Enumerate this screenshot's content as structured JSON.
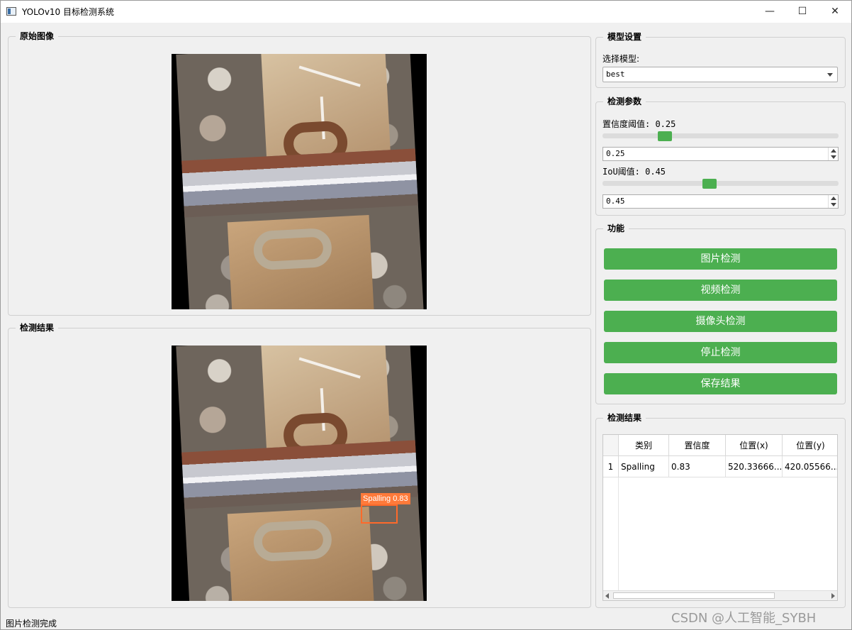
{
  "window": {
    "title": "YOLOv10 目标检测系统",
    "minimize_glyph": "—",
    "maximize_glyph": "☐",
    "close_glyph": "✕"
  },
  "original_panel": {
    "title": "原始图像"
  },
  "result_panel": {
    "title": "检测结果"
  },
  "detection_overlay": {
    "label": "Spalling  0.83",
    "color": "#ff6a2a"
  },
  "model_settings": {
    "title": "模型设置",
    "select_label": "选择模型:",
    "selected_model": "best"
  },
  "params": {
    "title": "检测参数",
    "conf_label": "置信度阈值: 0.25",
    "conf_value": "0.25",
    "conf_fraction": 0.25,
    "iou_label": "IoU阈值: 0.45",
    "iou_value": "0.45",
    "iou_fraction": 0.45
  },
  "functions": {
    "title": "功能",
    "buttons": [
      "图片检测",
      "视频检测",
      "摄像头检测",
      "停止检测",
      "保存结果"
    ],
    "button_color": "#4caf50"
  },
  "results_table": {
    "title": "检测结果",
    "headers": [
      "类别",
      "置信度",
      "位置(x)",
      "位置(y)"
    ],
    "rows": [
      {
        "index": "1",
        "class": "Spalling",
        "confidence": "0.83",
        "x": "520.33666...",
        "y": "420.05566..."
      }
    ]
  },
  "status": {
    "text": "图片检测完成"
  },
  "watermark": {
    "text": "CSDN @人工智能_SYBH"
  }
}
